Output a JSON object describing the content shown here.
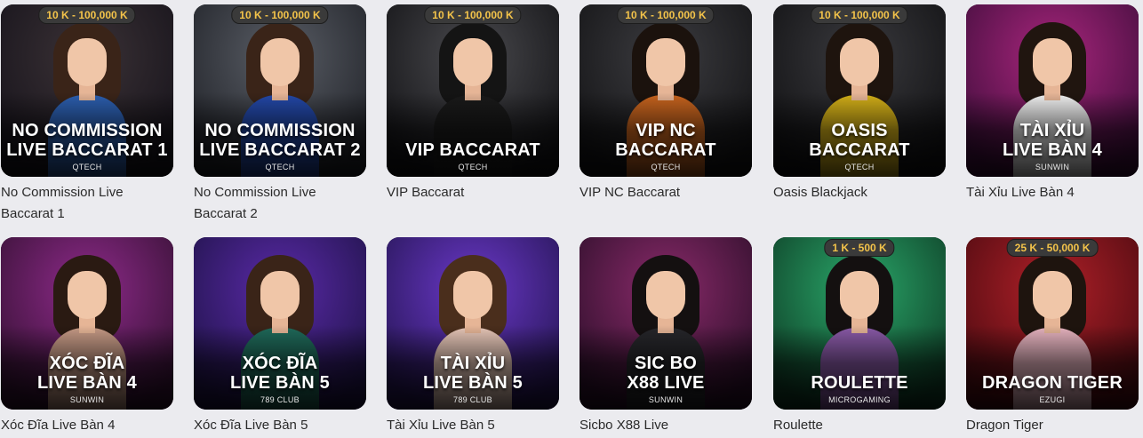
{
  "games": [
    {
      "limit": "10 K - 100,000 K",
      "line1": "NO COMMISSION",
      "line2": "LIVE BACCARAT 1",
      "provider": "QTECH",
      "name": "No Commission Live Baccarat 1",
      "bg": [
        "#3b3236",
        "#15121a"
      ],
      "hair": "#3a2418",
      "outfit": "#2c5fb0"
    },
    {
      "limit": "10 K - 100,000 K",
      "line1": "NO COMMISSION",
      "line2": "LIVE BACCARAT 2",
      "provider": "QTECH",
      "name": "No Commission Live Baccarat 2",
      "bg": [
        "#5a5e66",
        "#1e2026"
      ],
      "hair": "#3a2418",
      "outfit": "#2348a8"
    },
    {
      "limit": "10 K - 100,000 K",
      "line1": "",
      "line2": "VIP BACCARAT",
      "provider": "QTECH",
      "name": "VIP Baccarat",
      "bg": [
        "#4a4a4e",
        "#111114"
      ],
      "hair": "#141414",
      "outfit": "#1a1a1a"
    },
    {
      "limit": "10 K - 100,000 K",
      "line1": "VIP NC",
      "line2": "BACCARAT",
      "provider": "QTECH",
      "name": "VIP NC Baccarat",
      "bg": [
        "#3c3c40",
        "#121214"
      ],
      "hair": "#1b120d",
      "outfit": "#c8641e"
    },
    {
      "limit": "10 K - 100,000 K",
      "line1": "OASIS",
      "line2": "BACCARAT",
      "provider": "QTECH",
      "name": "Oasis Blackjack",
      "bg": [
        "#3a3a3e",
        "#101012"
      ],
      "hair": "#1e140e",
      "outfit": "#d4b018"
    },
    {
      "limit": "",
      "line1": "TÀI XỈU",
      "line2": "LIVE BÀN 4",
      "provider": "SUNWIN",
      "name": "Tài Xỉu Live Bàn 4",
      "bg": [
        "#a8257c",
        "#3d0d3a"
      ],
      "hair": "#20150f",
      "outfit": "#f2f2f2"
    },
    {
      "limit": "",
      "line1": "XÓC ĐĨA",
      "line2": "LIVE BÀN 4",
      "provider": "SUNWIN",
      "name": "Xóc Đĩa Live Bàn 4",
      "bg": [
        "#8e2a8a",
        "#321030"
      ],
      "hair": "#2a1a12",
      "outfit": "#c79a86"
    },
    {
      "limit": "",
      "line1": "XÓC ĐĨA",
      "line2": "LIVE BÀN 5",
      "provider": "789 CLUB",
      "name": "Xóc Đĩa Live Bàn 5",
      "bg": [
        "#5a2aa8",
        "#1d1245"
      ],
      "hair": "#3a2418",
      "outfit": "#1f6a5a"
    },
    {
      "limit": "",
      "line1": "TÀI XỈU",
      "line2": "LIVE BÀN 5",
      "provider": "789 CLUB",
      "name": "Tài Xỉu Live Bàn 5",
      "bg": [
        "#6a38c8",
        "#231450"
      ],
      "hair": "#4a2e1c",
      "outfit": "#e8c7b8"
    },
    {
      "limit": "",
      "line1": "SIC BO",
      "line2": "X88 LIVE",
      "provider": "SUNWIN",
      "name": "Sicbo X88 Live",
      "bg": [
        "#8a2a6a",
        "#2a0e28"
      ],
      "hair": "#141010",
      "outfit": "#26262a"
    },
    {
      "limit": "1 K - 500 K",
      "line1": "",
      "line2": "ROULETTE",
      "provider": "MICROGAMING",
      "name": "Roulette",
      "bg": [
        "#2aa86a",
        "#0d3a24"
      ],
      "hair": "#141010",
      "outfit": "#8a5aa8"
    },
    {
      "limit": "25 K - 50,000 K",
      "line1": "",
      "line2": "DRAGON TIGER",
      "provider": "EZUGI",
      "name": "Dragon Tiger",
      "bg": [
        "#b02028",
        "#4a0a10"
      ],
      "hair": "#1e140e",
      "outfit": "#e8b4c0"
    }
  ]
}
